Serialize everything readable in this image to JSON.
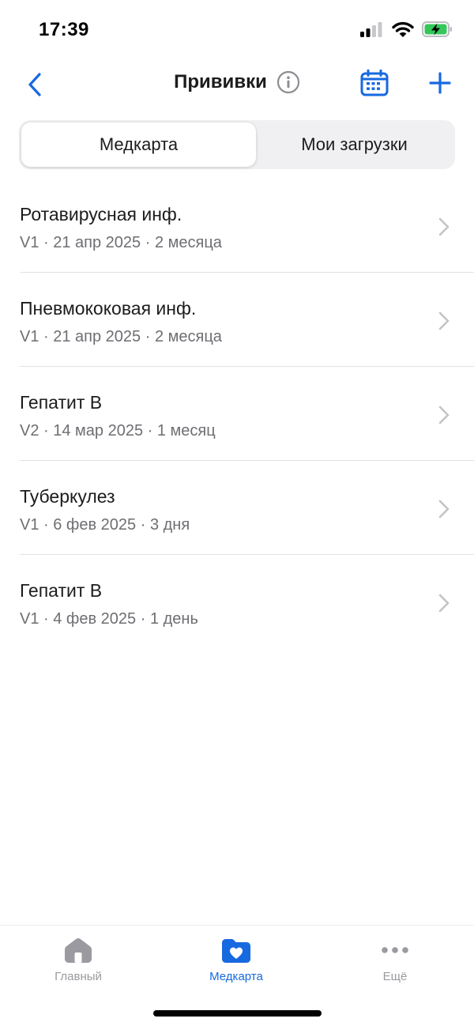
{
  "status_bar": {
    "time": "17:39",
    "signal_icon": "cellular-signal-icon",
    "wifi_icon": "wifi-icon",
    "battery_icon": "battery-charging-icon",
    "battery_color": "#34c759"
  },
  "nav": {
    "title": "Прививки",
    "back_icon": "chevron-left-icon",
    "info_icon": "info-icon",
    "calendar_icon": "calendar-icon",
    "add_icon": "plus-icon",
    "accent_color": "#1769e0"
  },
  "segments": {
    "medcard": "Медкарта",
    "uploads": "Мои загрузки",
    "selected": "Медкарта"
  },
  "vaccinations": [
    {
      "name": "Ротавирусная инф.",
      "details": "V1 · 21 апр 2025 · 2 месяца"
    },
    {
      "name": "Пневмококовая инф.",
      "details": "V1 · 21 апр 2025 · 2 месяца"
    },
    {
      "name": "Гепатит В",
      "details": "V2 · 14 мар 2025 · 1 месяц"
    },
    {
      "name": "Туберкулез",
      "details": "V1 · 6 фев 2025 · 3 дня"
    },
    {
      "name": "Гепатит В",
      "details": "V1 · 4 фев 2025 · 1 день"
    }
  ],
  "tab_bar": {
    "home": "Главный",
    "medcard": "Медкарта",
    "more": "Ещё",
    "home_icon": "house-icon",
    "medcard_icon": "folder-heart-icon",
    "more_icon": "ellipsis-icon",
    "active": "Медкарта"
  }
}
